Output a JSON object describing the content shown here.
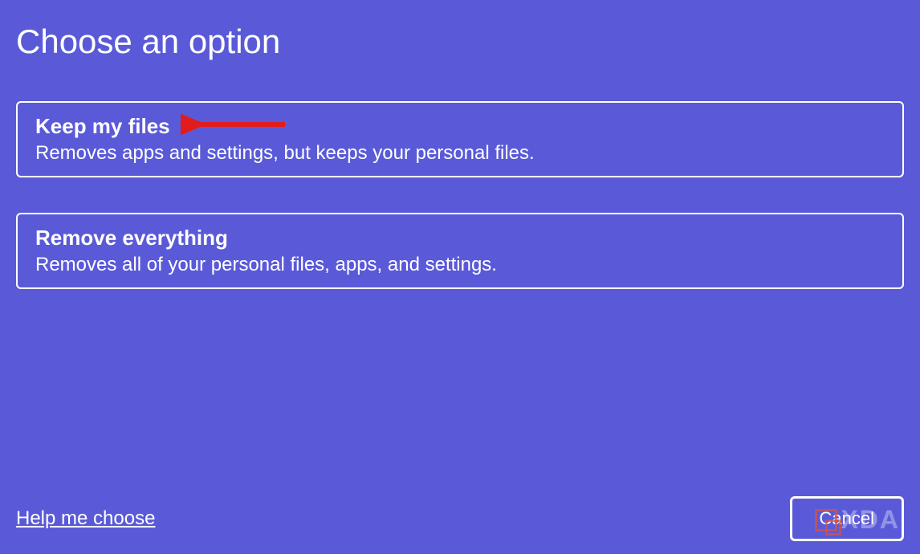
{
  "header": {
    "title": "Choose an option"
  },
  "options": [
    {
      "title": "Keep my files",
      "description": "Removes apps and settings, but keeps your personal files."
    },
    {
      "title": "Remove everything",
      "description": "Removes all of your personal files, apps, and settings."
    }
  ],
  "footer": {
    "help_link": "Help me choose",
    "cancel_label": "Cancel"
  },
  "annotation": {
    "arrow_color": "#e21b1b"
  },
  "watermark": {
    "text": "XDA"
  }
}
